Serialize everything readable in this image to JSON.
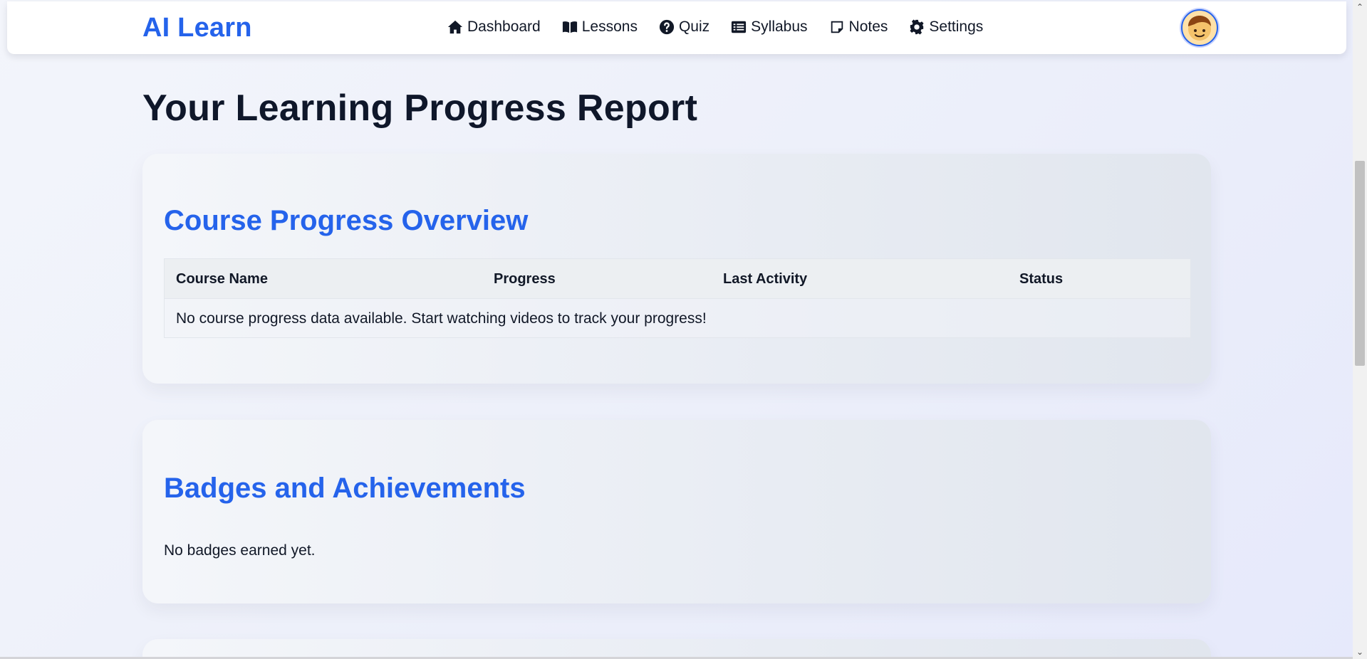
{
  "brand": {
    "name": "AI Learn",
    "color": "#2563eb"
  },
  "nav": {
    "items": [
      {
        "label": "Dashboard",
        "icon": "home-icon"
      },
      {
        "label": "Lessons",
        "icon": "book-open-icon"
      },
      {
        "label": "Quiz",
        "icon": "question-circle-icon"
      },
      {
        "label": "Syllabus",
        "icon": "list-icon"
      },
      {
        "label": "Notes",
        "icon": "sticky-note-icon"
      },
      {
        "label": "Settings",
        "icon": "gear-icon"
      }
    ],
    "avatar": "user-avatar-emoji"
  },
  "page": {
    "title": "Your Learning Progress Report"
  },
  "course_progress": {
    "title": "Course Progress Overview",
    "columns": [
      "Course Name",
      "Progress",
      "Last Activity",
      "Status"
    ],
    "empty_message": "No course progress data available. Start watching videos to track your progress!"
  },
  "badges": {
    "title": "Badges and Achievements",
    "empty_message": "No badges earned yet."
  },
  "colors": {
    "accent": "#2563eb",
    "text": "#111827"
  }
}
